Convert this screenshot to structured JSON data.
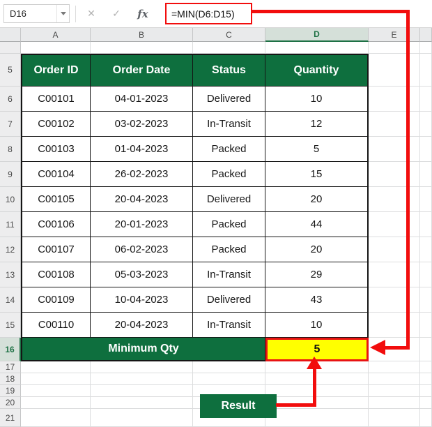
{
  "formula_bar": {
    "name_box_value": "D16",
    "cancel_label": "✕",
    "enter_label": "✓",
    "function_label": "fx",
    "formula": "=MIN(D6:D15)"
  },
  "sheet": {
    "column_headers": [
      "A",
      "B",
      "C",
      "D",
      "E"
    ],
    "selected_column": "D",
    "selected_row": "16",
    "row_numbers": [
      "5",
      "6",
      "7",
      "8",
      "9",
      "10",
      "11",
      "12",
      "13",
      "14",
      "15",
      "16",
      "17",
      "18",
      "19",
      "20",
      "21"
    ]
  },
  "table": {
    "header": {
      "order_id": "Order ID",
      "order_date": "Order Date",
      "status": "Status",
      "quantity": "Quantity"
    },
    "rows": [
      {
        "order_id": "C00101",
        "order_date": "04-01-2023",
        "status": "Delivered",
        "quantity": "10"
      },
      {
        "order_id": "C00102",
        "order_date": "03-02-2023",
        "status": "In-Transit",
        "quantity": "12"
      },
      {
        "order_id": "C00103",
        "order_date": "01-04-2023",
        "status": "Packed",
        "quantity": "5"
      },
      {
        "order_id": "C00104",
        "order_date": "26-02-2023",
        "status": "Packed",
        "quantity": "15"
      },
      {
        "order_id": "C00105",
        "order_date": "20-04-2023",
        "status": "Delivered",
        "quantity": "20"
      },
      {
        "order_id": "C00106",
        "order_date": "20-01-2023",
        "status": "Packed",
        "quantity": "44"
      },
      {
        "order_id": "C00107",
        "order_date": "06-02-2023",
        "status": "Packed",
        "quantity": "20"
      },
      {
        "order_id": "C00108",
        "order_date": "05-03-2023",
        "status": "In-Transit",
        "quantity": "29"
      },
      {
        "order_id": "C00109",
        "order_date": "10-04-2023",
        "status": "Delivered",
        "quantity": "43"
      },
      {
        "order_id": "C00110",
        "order_date": "20-04-2023",
        "status": "In-Transit",
        "quantity": "10"
      }
    ],
    "summary_label": "Minimum Qty",
    "summary_value": "5"
  },
  "callout": {
    "result_label": "Result"
  },
  "colors": {
    "excel_green": "#0e6f3e",
    "highlight_yellow": "#ffff00",
    "arrow_red": "#f20d0d",
    "selected_header_green": "#1e7145"
  }
}
